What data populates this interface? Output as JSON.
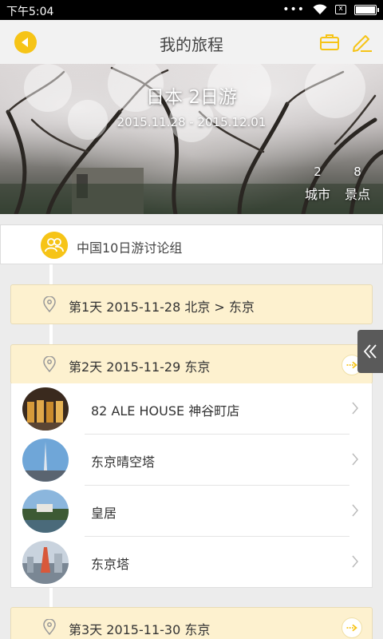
{
  "status_bar": {
    "time": "下午5:04",
    "sim_label": "x"
  },
  "nav": {
    "title": "我的旅程",
    "icons": [
      "back-arrow-icon",
      "suitcase-icon",
      "edit-pen-icon"
    ]
  },
  "hero": {
    "title": "日本 2日游",
    "dates": "2015.11.28 - 2015.12.01",
    "stats": [
      {
        "value": "2",
        "label": "城市"
      },
      {
        "value": "8",
        "label": "景点"
      }
    ]
  },
  "group": {
    "label": "中国10日游讨论组",
    "icon": "people-icon"
  },
  "days": [
    {
      "label": "第1天 2015-11-28 北京 > 东京"
    },
    {
      "label": "第2天 2015-11-29 东京"
    },
    {
      "label": "第3天 2015-11-30 东京"
    }
  ],
  "places": [
    {
      "name": "82 ALE HOUSE 神谷町店"
    },
    {
      "name": "东京晴空塔"
    },
    {
      "name": "皇居"
    },
    {
      "name": "东京塔"
    }
  ],
  "colors": {
    "accent": "#f6c417",
    "day_bg": "#fdf1cf",
    "bg": "#ececec"
  }
}
